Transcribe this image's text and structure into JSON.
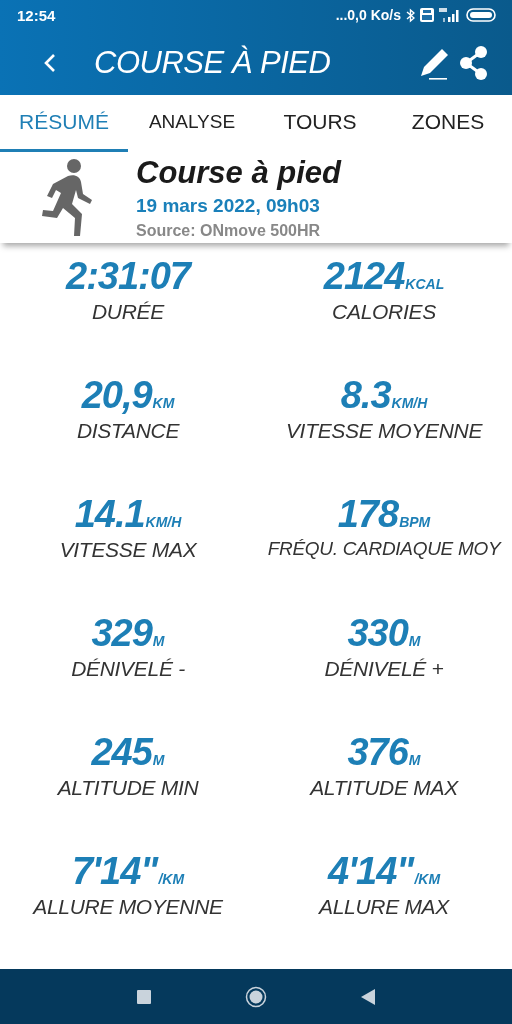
{
  "status_bar": {
    "time": "12:54",
    "network_speed": "...0,0 Ko/s"
  },
  "app_bar": {
    "title": "COURSE À PIED"
  },
  "tabs": [
    {
      "label": "RÉSUMÉ",
      "selected": true
    },
    {
      "label": "ANALYSE",
      "selected": false
    },
    {
      "label": "TOURS",
      "selected": false
    },
    {
      "label": "ZONES",
      "selected": false
    }
  ],
  "activity": {
    "title": "Course à pied",
    "date": "19 mars 2022, 09h03",
    "source": "Source: ONmove 500HR"
  },
  "stats": [
    {
      "value": "2:31:07",
      "label": "DURÉE"
    },
    {
      "value": "2124",
      "unit": "KCAL",
      "label": "CALORIES"
    },
    {
      "value": "20,9",
      "unit": "KM",
      "label": "DISTANCE"
    },
    {
      "value": "8.3",
      "unit": "KM/H",
      "label": "VITESSE MOYENNE"
    },
    {
      "value": "14.1",
      "unit": "KM/H",
      "label": "VITESSE MAX"
    },
    {
      "value": "178",
      "unit": "BPM",
      "label": "FRÉQU. CARDIAQUE MOY"
    },
    {
      "value": "329",
      "unit": "M",
      "label": "DÉNIVELÉ -"
    },
    {
      "value": "330",
      "unit": "M",
      "label": "DÉNIVELÉ +"
    },
    {
      "value": "245",
      "unit": "M",
      "label": "ALTITUDE MIN"
    },
    {
      "value": "376",
      "unit": "M",
      "label": "ALTITUDE MAX"
    },
    {
      "value": "7'14\"",
      "unit": "/KM",
      "label": "ALLURE MOYENNE"
    },
    {
      "value": "4'14\"",
      "unit": "/KM",
      "label": "ALLURE MAX"
    }
  ]
}
